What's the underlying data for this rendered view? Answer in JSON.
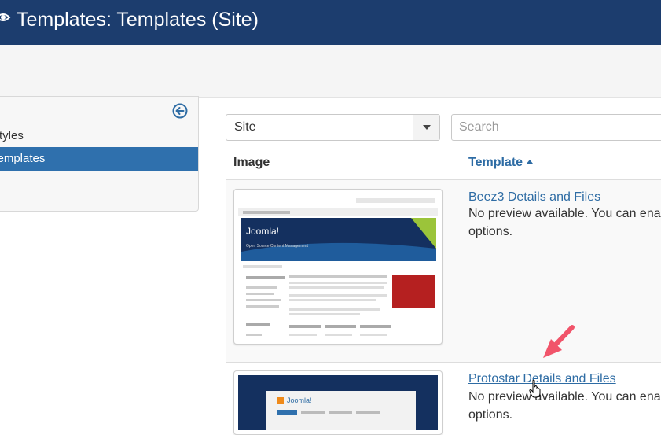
{
  "header": {
    "title": "Templates: Templates (Site)",
    "icon": "eye-icon"
  },
  "sidebar": {
    "items": [
      {
        "label": "Styles",
        "active": false
      },
      {
        "label": "Templates",
        "active": true
      }
    ],
    "toggle_icon": "arrow-left-circle-icon"
  },
  "filters": {
    "location_selected": "Site",
    "search_placeholder": "Search"
  },
  "table": {
    "headers": {
      "image": "Image",
      "template": "Template"
    },
    "rows": [
      {
        "link": "Beez3 Details and Files",
        "desc_line1": "No preview available. You can enable",
        "desc_line2": "options.",
        "thumb": {
          "logo": "Joomla!",
          "tagline": "Open Source Content Management"
        }
      },
      {
        "link": "Protostar Details and Files",
        "desc_line1": "No preview available. You can enable",
        "desc_line2": "options.",
        "thumb": {
          "logo": "Joomla!"
        }
      }
    ]
  },
  "colors": {
    "header_bg": "#1c3d6e",
    "active_bg": "#2f70ad",
    "link": "#2e6ca4",
    "annotation": "#f1546a"
  }
}
